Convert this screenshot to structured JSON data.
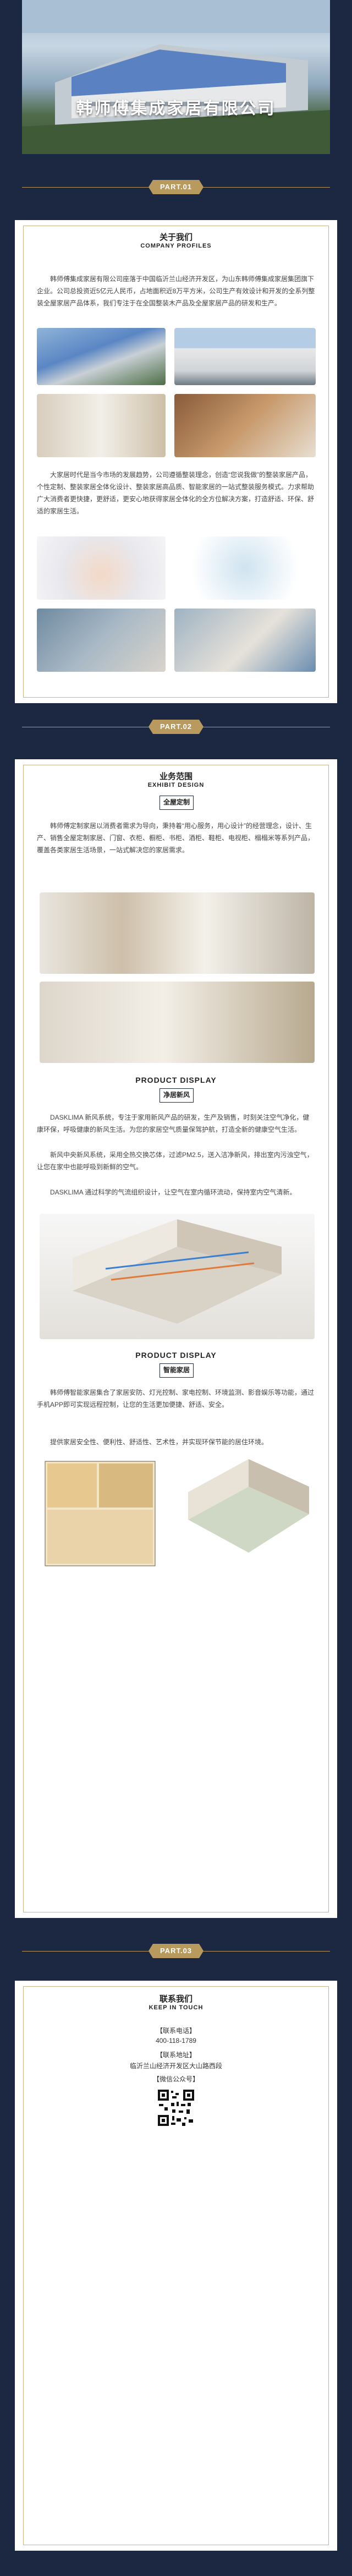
{
  "hero": {
    "title": "韩师傅集成家居有限公司"
  },
  "parts": [
    "PART.01",
    "PART.02",
    "PART.03"
  ],
  "about": {
    "title_cn": "关于我们",
    "title_en": "COMPANY PROFILES",
    "para1": "韩师傅集成家居有限公司座落于中国临沂兰山经济开发区，为山东韩师傅集成家居集团旗下企业。公司总投资近5亿元人民币，占地面积近8万平方米，公司生产有效设计和开发的全系列整装全屋家居产品体系，我们专注于在全国整装木产品及全屋家居产品的研发和生产。",
    "para2": "大家居时代是当今市场的发展趋势，公司遵循整装理念，创造“您说我做”的整装家居产品，个性定制、整装家居全体化设计、整装家居高品质、智能家居的一站式整装服务模式。力求帮助广大消费者更快捷，更舒适，更安心地获得家居全体化的全方位解决方案，打造舒适、环保、舒适的家居生活。"
  },
  "business": {
    "title_cn": "业务范围",
    "title_en": "EXHIBIT DESIGN",
    "tag1": "全屋定制",
    "para1": "韩师傅定制家居以消费者需求为导向，秉持着“用心服务，用心设计”的经营理念，设计、生产、销售全屋定制家居、门窗、衣柜、橱柜、书柜、酒柜、鞋柜、电视柜、榻榻米等系列产品，覆盖各类家居生活场景，一站式解决您的家居需求。",
    "product_display_1": "PRODUCT DISPLAY",
    "tag2": "净居新风",
    "para2": "DASKLIMA 新风系统，专注于家用新风产品的研发，生产及销售，时刻关注空气净化，健康环保，呼吸健康的新风生活。为您的家居空气质量保驾护航，打造全新的健康空气生活。",
    "para3": "新风中央新风系统，采用全热交换芯体，过滤PM2.5，送入洁净新风，排出室内污浊空气，让您在家中也能呼吸到新鲜的空气。",
    "para4": "DASKLIMA 通过科学的气流组织设计，让空气在室内循环流动，保持室内空气清新。",
    "product_display_2": "PRODUCT DISPLAY",
    "tag3": "智能家居",
    "para5": "韩师傅智能家居集合了家居安防、灯光控制、家电控制、环境监测、影音娱乐等功能，通过手机APP即可实现远程控制，让您的生活更加便捷、舒适、安全。",
    "para6": "提供家居安全性、便利性、舒适性、艺术性，并实现环保节能的居住环境。"
  },
  "contact": {
    "title_cn": "联系我们",
    "title_en": "KEEP IN TOUCH",
    "phone_label": "【联系电话】",
    "phone": "400-118-1789",
    "address_label": "【联系地址】",
    "address": "临沂兰山经济开发区大山路西段",
    "wechat_label": "【微信公众号】"
  }
}
